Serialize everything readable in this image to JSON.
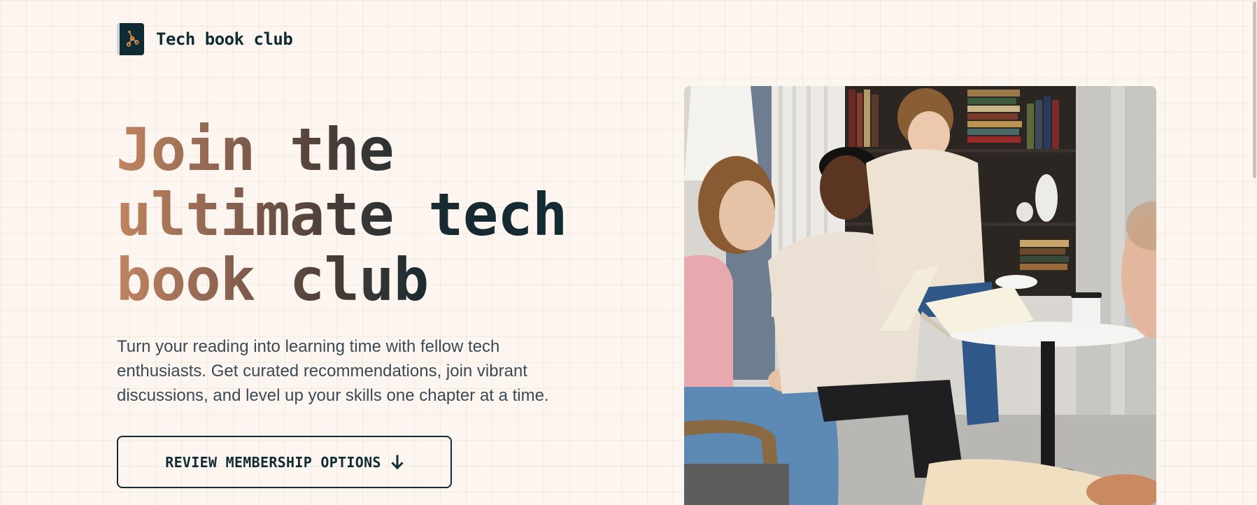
{
  "brand": {
    "name": "Tech book club",
    "logo_icon": "book-network-icon",
    "colors": {
      "dark": "#0f2b33",
      "accent": "#c08560",
      "background": "#fdf5ef"
    }
  },
  "hero": {
    "title_lines": [
      "Join the",
      "ultimate tech",
      "book club"
    ],
    "description": "Turn your reading into learning time with fellow tech enthusiasts. Get curated recommendations, join vibrant discussions, and level up your skills one chapter at a time.",
    "cta_label": "REVIEW MEMBERSHIP OPTIONS",
    "cta_icon": "arrow-down-icon",
    "image_alt": "Group of people reading books together around a cafe table"
  }
}
